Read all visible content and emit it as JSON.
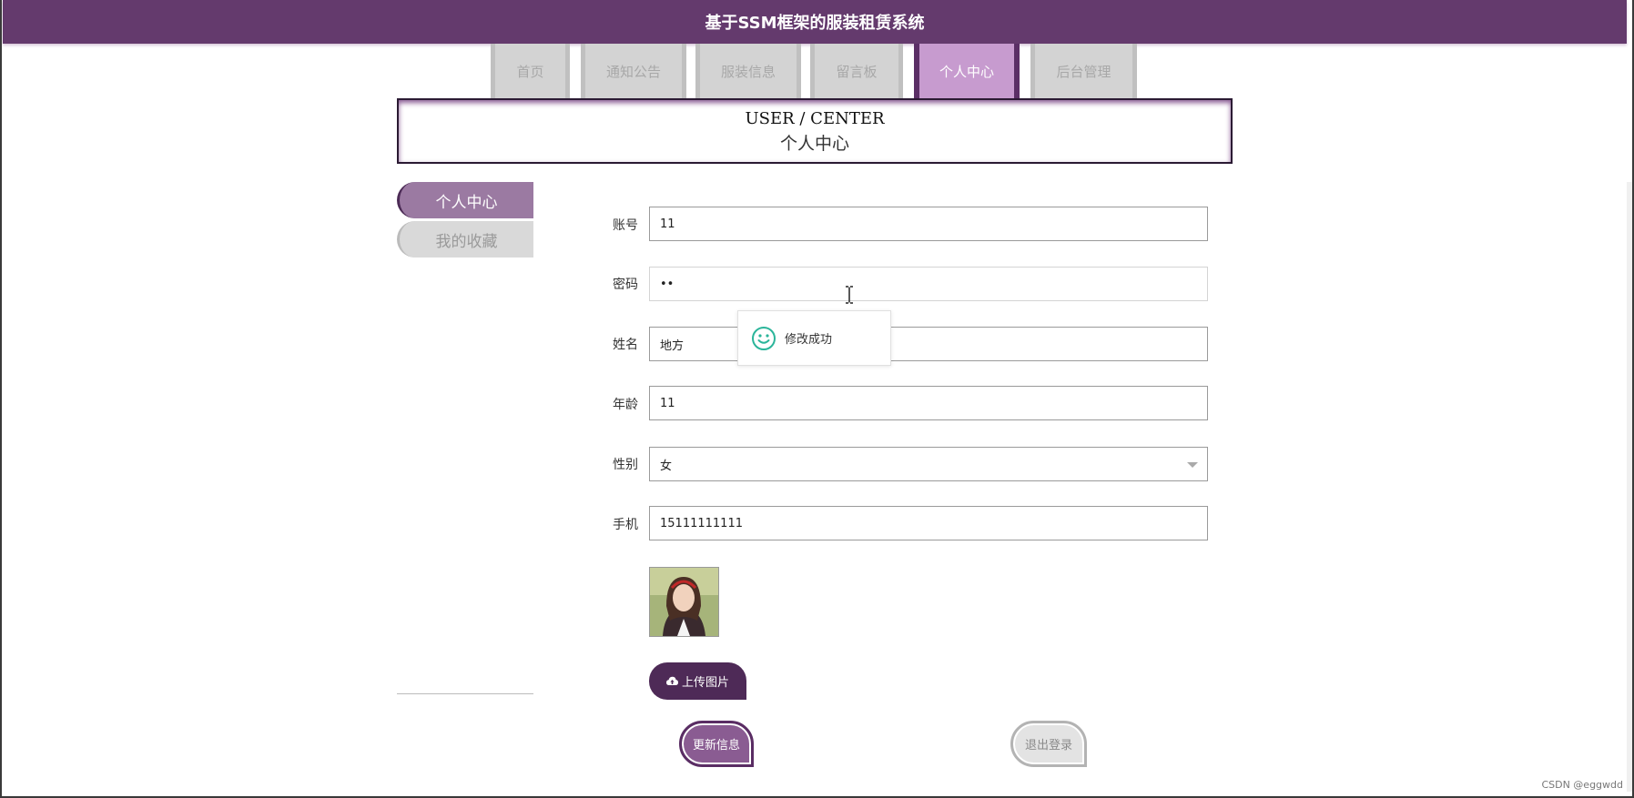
{
  "header": {
    "title": "基于SSM框架的服装租赁系统"
  },
  "nav": {
    "items": [
      {
        "label": "首页"
      },
      {
        "label": "通知公告"
      },
      {
        "label": "服装信息"
      },
      {
        "label": "留言板"
      },
      {
        "label": "个人中心",
        "active": true
      },
      {
        "label": "后台管理"
      }
    ]
  },
  "page_title": {
    "en": "USER / CENTER",
    "cn": "个人中心"
  },
  "sidebar": {
    "items": [
      {
        "label": "个人中心",
        "active": true
      },
      {
        "label": "我的收藏"
      }
    ]
  },
  "form": {
    "account": {
      "label": "账号",
      "value": "11"
    },
    "password": {
      "label": "密码",
      "value": "••"
    },
    "name": {
      "label": "姓名",
      "value": "地方"
    },
    "age": {
      "label": "年龄",
      "value": "11"
    },
    "gender": {
      "label": "性别",
      "value": "女"
    },
    "phone": {
      "label": "手机",
      "value": "15111111111"
    }
  },
  "toast": {
    "message": "修改成功",
    "icon": "smile-icon"
  },
  "buttons": {
    "upload": "上传图片",
    "update": "更新信息",
    "logout": "退出登录"
  },
  "watermark": "CSDN @eggwdd",
  "colors": {
    "primary": "#643a6d",
    "accent": "#c79bcf",
    "toast_icon": "#2bb59a"
  }
}
